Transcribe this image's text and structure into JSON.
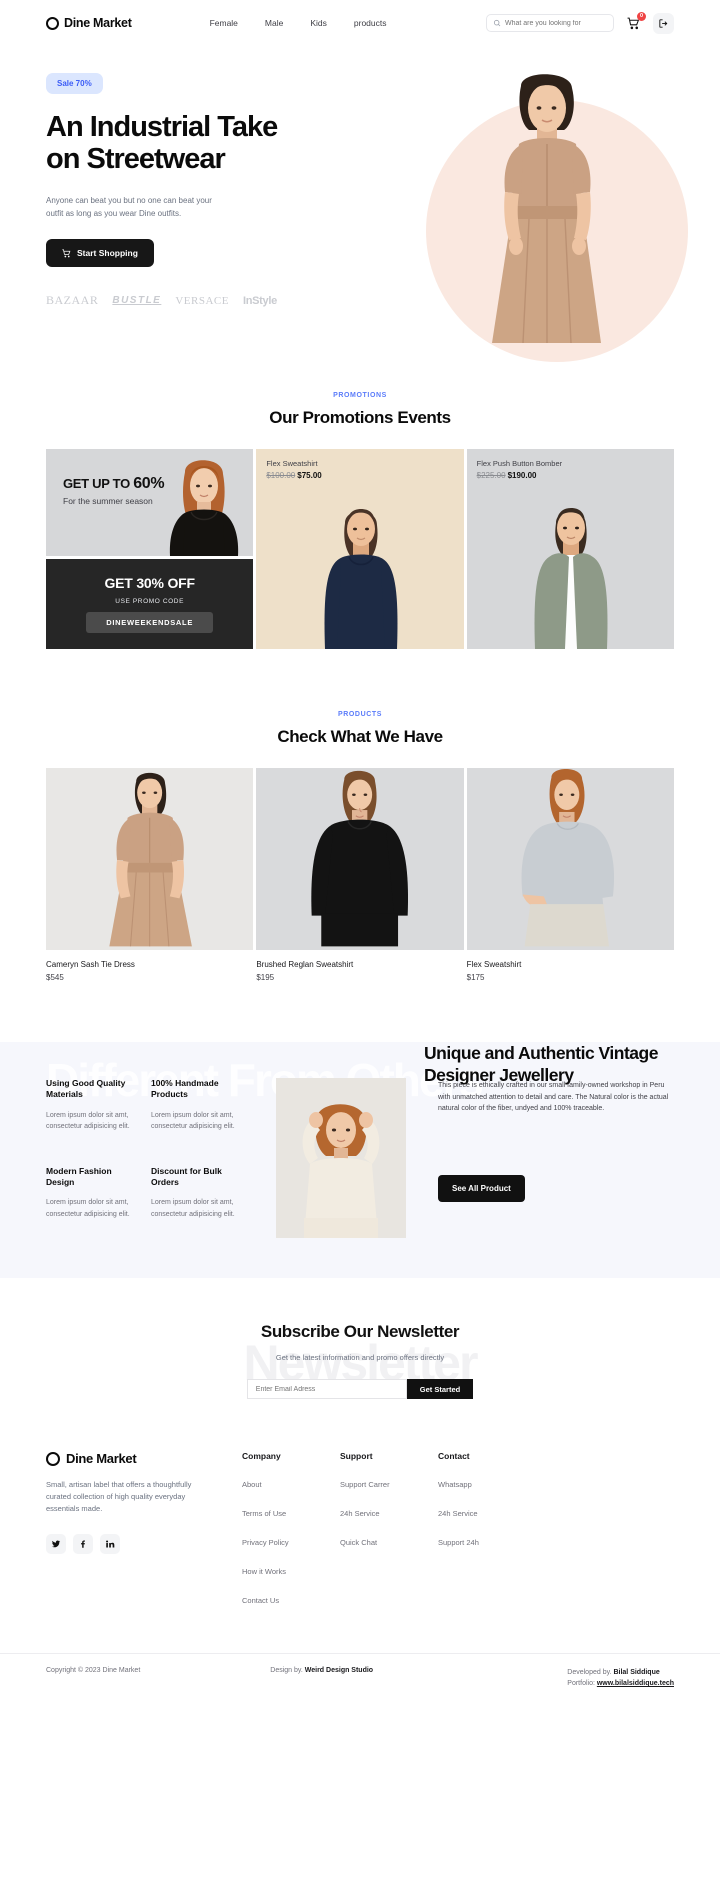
{
  "header": {
    "brand": "Dine Market",
    "nav": [
      {
        "label": "Female"
      },
      {
        "label": "Male"
      },
      {
        "label": "Kids"
      },
      {
        "label": "products"
      }
    ],
    "search_placeholder": "What are you looking for",
    "cart_badge": "0"
  },
  "hero": {
    "badge": "Sale 70%",
    "title": "An Industrial Take on Streetwear",
    "subtitle": "Anyone can beat you but no one can beat your outfit as long as you wear Dine outfits.",
    "cta": "Start Shopping",
    "logos": [
      "BAZAAR",
      "BUSTLE",
      "VERSACE",
      "InStyle"
    ]
  },
  "promotions": {
    "kicker": "PROMOTIONS",
    "title": "Our Promotions Events",
    "offer_heading_prefix": "GET UP TO ",
    "offer_heading_value": "60%",
    "offer_sub": "For the summer season",
    "discount_heading": "GET 30% OFF",
    "use_promo_label": "USE PROMO CODE",
    "promo_code": "DINEWEEKENDSALE",
    "cards": [
      {
        "name": "Flex Sweatshirt",
        "old_price": "$100.00",
        "new_price": "$75.00"
      },
      {
        "name": "Flex Push Button Bomber",
        "old_price": "$225.00",
        "new_price": "$190.00"
      }
    ]
  },
  "products": {
    "kicker": "PRODUCTS",
    "title": "Check What We Have",
    "items": [
      {
        "name": "Cameryn Sash Tie Dress",
        "price": "$545"
      },
      {
        "name": "Brushed Reglan Sweatshirt",
        "price": "$195"
      },
      {
        "name": "Flex Sweatshirt",
        "price": "$175"
      }
    ]
  },
  "jewellery": {
    "title": "Unique and Authentic Vintage Designer Jewellery",
    "ghost_text": "Different From Others",
    "features": [
      {
        "title": "Using Good Quality Materials",
        "desc": "Lorem ipsum dolor sit amt, consectetur adipisicing elit."
      },
      {
        "title": "100% Handmade Products",
        "desc": "Lorem ipsum dolor sit amt, consectetur adipisicing elit."
      },
      {
        "title": "Modern Fashion Design",
        "desc": "Lorem ipsum dolor sit amt, consectetur adipisicing elit."
      },
      {
        "title": "Discount for Bulk Orders",
        "desc": "Lorem ipsum dolor sit amt, consectetur adipisicing elit."
      }
    ],
    "description": "This piece is ethically crafted in our small family-owned workshop in Peru with unmatched attention to detail and care. The Natural color is the actual natural color of the fiber, undyed and 100% traceable.",
    "cta": "See All Product"
  },
  "newsletter": {
    "ghost_text": "Newsletter",
    "title": "Subscribe Our Newsletter",
    "subtitle": "Get the latest information and promo offers directly",
    "input_placeholder": "Enter Email Adress",
    "button": "Get Started"
  },
  "footer": {
    "brand": "Dine Market",
    "description": "Small, artisan label that offers a thoughtfully curated collection of high quality everyday essentials made.",
    "socials": [
      "twitter-icon",
      "facebook-icon",
      "linkedin-icon"
    ],
    "columns": [
      {
        "title": "Company",
        "links": [
          "About",
          "Terms of Use",
          "Privacy Policy",
          "How it Works",
          "Contact Us"
        ]
      },
      {
        "title": "Support",
        "links": [
          "Support Carrer",
          "24h Service",
          "Quick Chat"
        ]
      },
      {
        "title": "Contact",
        "links": [
          "Whatsapp",
          "24h Service",
          "Support 24h"
        ]
      }
    ],
    "copyright": "Copyright © 2023 Dine Market",
    "design_prefix": "Design by. ",
    "design_name": "Weird Design Studio",
    "dev_prefix": "Developed by. ",
    "dev_name": "Bilal Siddique",
    "portfolio_prefix": "Portfolio: ",
    "portfolio_link": "www.bilalsiddique.tech"
  },
  "colors": {
    "accent_blue": "#3b5cf6",
    "badge_bg": "#dbe6fe",
    "dark": "#171717",
    "hero_circle": "#fae8e0",
    "beige": "#eee0c9",
    "grey": "#d6d7d9",
    "band": "#f6f7fc",
    "badge_red": "#ef4444"
  }
}
